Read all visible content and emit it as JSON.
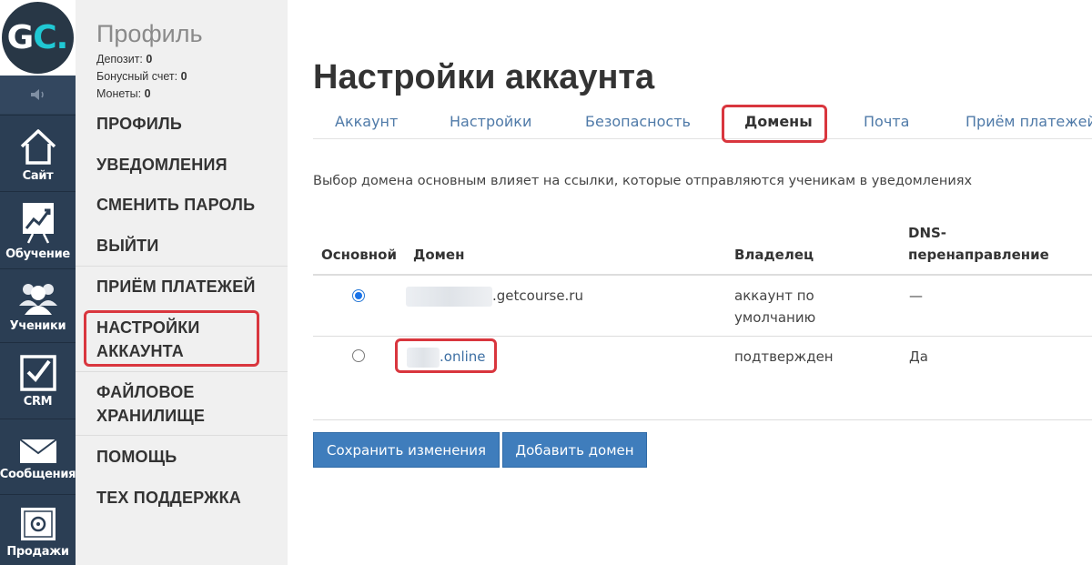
{
  "logo": {
    "letters_main": "G",
    "letters_accent": "C",
    "dot": "."
  },
  "rail": {
    "speaker_icon": "speaker-icon",
    "items": [
      {
        "label": "Сайт",
        "icon": "home-icon"
      },
      {
        "label": "Обучение",
        "icon": "chart-icon"
      },
      {
        "label": "Ученики",
        "icon": "users-icon"
      },
      {
        "label": "CRM",
        "icon": "checkbox-icon"
      },
      {
        "label": "Сообщения",
        "icon": "envelope-icon"
      },
      {
        "label": "Продажи",
        "icon": "safe-icon"
      }
    ]
  },
  "profile": {
    "title": "Профиль",
    "deposit_label": "Депозит:",
    "deposit_value": "0",
    "bonus_label": "Бонусный счет:",
    "bonus_value": "0",
    "coins_label": "Монеты:",
    "coins_value": "0"
  },
  "menu": {
    "profile": "ПРОФИЛЬ",
    "notifications": "УВЕДОМЛЕНИЯ",
    "change_password": "СМЕНИТЬ ПАРОЛЬ",
    "logout": "ВЫЙТИ",
    "payments": "ПРИЁМ ПЛАТЕЖЕЙ",
    "account_settings_1": "НАСТРОЙКИ",
    "account_settings_2": "АККАУНТА",
    "file_storage_1": "ФАЙЛОВОЕ",
    "file_storage_2": "ХРАНИЛИЩЕ",
    "help": "ПОМОЩЬ",
    "support": "ТЕХ ПОДДЕРЖКА"
  },
  "page": {
    "title": "Настройки аккаунта",
    "description": "Выбор домена основным влияет на ссылки, которые отправляются ученикам в уведомлениях"
  },
  "tabs": {
    "account": "Аккаунт",
    "settings": "Настройки",
    "security": "Безопасность",
    "domains": "Домены",
    "mail": "Почта",
    "payments": "Приём платежей",
    "active": "Домены"
  },
  "table": {
    "headers": {
      "primary": "Основной",
      "domain": "Домен",
      "owner": "Владелец",
      "dns_1": "DNS-",
      "dns_2": "перенаправление"
    },
    "rows": [
      {
        "primary": true,
        "domain_suffix": ".getcourse.ru",
        "owner_1": "аккаунт по",
        "owner_2": "умолчанию",
        "dns": "—"
      },
      {
        "primary": false,
        "domain_suffix": ".online",
        "owner_1": "подтвержден",
        "owner_2": "",
        "dns": "Да"
      }
    ]
  },
  "buttons": {
    "save": "Сохранить изменения",
    "add_domain": "Добавить домен"
  },
  "colors": {
    "rail_bg": "#2b3e54",
    "menu_bg": "#f0f0f0",
    "accent_blue": "#3f7dbc",
    "highlight_red": "#d9363e",
    "logo_accent": "#20c8d4"
  }
}
